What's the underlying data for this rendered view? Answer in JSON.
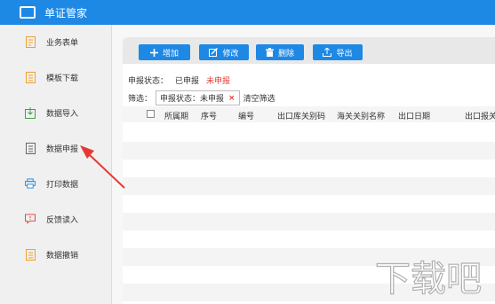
{
  "app": {
    "title": "单证管家"
  },
  "sidebar": {
    "items": [
      {
        "label": "业务表单",
        "icon": "form-icon"
      },
      {
        "label": "模板下载",
        "icon": "template-icon"
      },
      {
        "label": "数据导入",
        "icon": "import-icon"
      },
      {
        "label": "数据申报",
        "icon": "declare-icon"
      },
      {
        "label": "打印数据",
        "icon": "printer-icon"
      },
      {
        "label": "反馈读入",
        "icon": "feedback-icon"
      },
      {
        "label": "数据撤销",
        "icon": "revoke-icon"
      }
    ]
  },
  "toolbar": {
    "add_label": "增加",
    "edit_label": "修改",
    "delete_label": "删除",
    "export_label": "导出"
  },
  "status": {
    "label": "申报状态：",
    "declared": "已申报",
    "undeclared": "未申报"
  },
  "filter": {
    "label": "筛选：",
    "chip": "申报状态：未申报",
    "chip_close": "×",
    "clear": "清空筛选"
  },
  "table": {
    "columns": [
      "所属期",
      "序号",
      "编号",
      "出口库关别码",
      "海关关别名称",
      "出口日期",
      "出口报关"
    ]
  },
  "watermark": {
    "text": "下载吧"
  },
  "colors": {
    "accent": "#1e88e5",
    "alert": "#e53935"
  }
}
